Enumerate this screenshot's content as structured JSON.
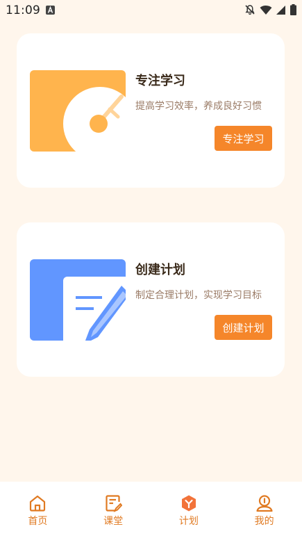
{
  "status_bar": {
    "time": "11:09",
    "icons": [
      "a-icon",
      "bell-off-icon",
      "wifi-icon",
      "signal-icon",
      "battery-icon"
    ]
  },
  "cards": [
    {
      "title": "专注学习",
      "subtitle": "提高学习效率，养成良好习惯",
      "button_label": "专注学习",
      "icon": "focus-timer-icon",
      "color": "#FFB44D"
    },
    {
      "title": "创建计划",
      "subtitle": "制定合理计划，实现学习目标",
      "button_label": "创建计划",
      "icon": "plan-document-icon",
      "color": "#6196FF"
    }
  ],
  "bottom_nav": {
    "active_index": 2,
    "items": [
      {
        "label": "首页",
        "icon": "home-icon"
      },
      {
        "label": "课堂",
        "icon": "classroom-icon"
      },
      {
        "label": "计划",
        "icon": "plan-icon"
      },
      {
        "label": "我的",
        "icon": "profile-icon"
      }
    ]
  },
  "colors": {
    "background": "#FFF6EC",
    "accent": "#F5862A",
    "card": "#FFFFFF"
  }
}
